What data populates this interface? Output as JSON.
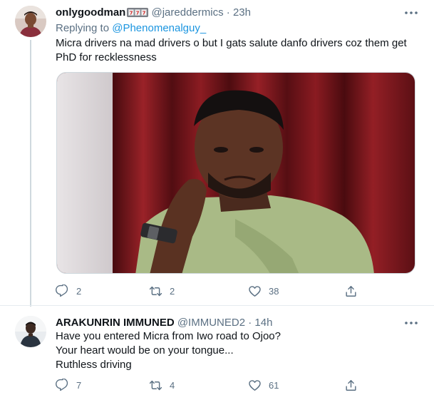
{
  "tweets": [
    {
      "display_name": "onlygoodman",
      "handle": "@jareddermics",
      "separator": "·",
      "time": "23h",
      "reply_prefix": "Replying to",
      "reply_handle": "@Phenomenalguy_",
      "text_lines": [
        "Micra drivers na mad drivers o but I gats salute danfo drivers coz them get",
        "PhD for recklessness"
      ],
      "reply_count": "2",
      "retweet_count": "2",
      "like_count": "38"
    },
    {
      "display_name": "ARAKUNRIN IMMUNED",
      "handle": "@IMMUNED2",
      "separator": "·",
      "time": "14h",
      "text_lines": [
        "Have you entered Micra from Iwo road to Ojoo?",
        "Your heart would be on your tongue...",
        "Ruthless driving"
      ],
      "reply_count": "7",
      "retweet_count": "4",
      "like_count": "61"
    }
  ],
  "icons": {
    "more": "more-horizontal-icon",
    "reply": "reply-icon",
    "retweet": "retweet-icon",
    "like": "heart-icon",
    "share": "share-icon",
    "name_badge": "slot-machine-emoji"
  },
  "colors": {
    "link": "#1b95e0",
    "secondary_text": "#5b7083",
    "primary_text": "#0f1419",
    "divider": "#e6ecf0"
  }
}
